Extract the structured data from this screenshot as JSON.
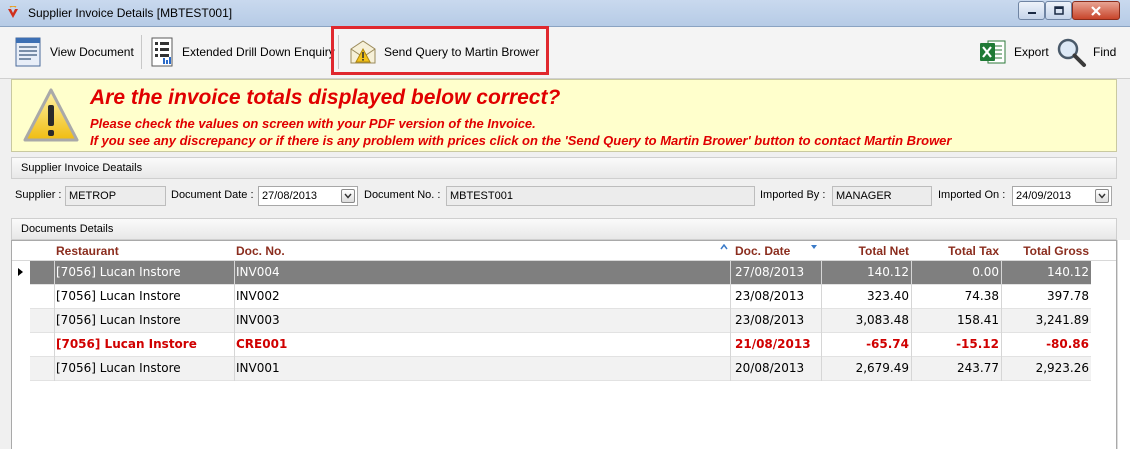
{
  "window": {
    "title": "Supplier Invoice Details [MBTEST001]"
  },
  "toolbar": {
    "view_document": "View Document",
    "extended_drill_down": "Extended Drill Down Enquiry",
    "send_query": "Send Query to Martin Brower",
    "export": "Export",
    "find": "Find"
  },
  "alert": {
    "headline": "Are the invoice totals displayed below correct?",
    "line1": "Please check the values on screen with your PDF version of the Invoice.",
    "line2": "If you see any discrepancy or if there is any problem with prices click on the 'Send Query to Martin Brower' button to contact Martin Brower"
  },
  "supplier_section": {
    "header": "Supplier Invoice Deatails",
    "supplier_label": "Supplier :",
    "supplier_value": "METROP",
    "document_date_label": "Document Date :",
    "document_date_value": "27/08/2013",
    "document_no_label": "Document No. :",
    "document_no_value": "MBTEST001",
    "imported_by_label": "Imported By :",
    "imported_by_value": "MANAGER",
    "imported_on_label": "Imported On :",
    "imported_on_value": "24/09/2013"
  },
  "documents_section": {
    "header": "Documents Details",
    "columns": {
      "restaurant": "Restaurant",
      "doc_no": "Doc. No.",
      "doc_date": "Doc. Date",
      "total_net": "Total Net",
      "total_tax": "Total Tax",
      "total_gross": "Total Gross"
    },
    "rows": [
      {
        "restaurant": "[7056] Lucan Instore",
        "doc_no": "INV004",
        "doc_date": "27/08/2013",
        "total_net": "140.12",
        "total_tax": "0.00",
        "total_gross": "140.12"
      },
      {
        "restaurant": "[7056] Lucan Instore",
        "doc_no": "INV002",
        "doc_date": "23/08/2013",
        "total_net": "323.40",
        "total_tax": "74.38",
        "total_gross": "397.78"
      },
      {
        "restaurant": "[7056] Lucan Instore",
        "doc_no": "INV003",
        "doc_date": "23/08/2013",
        "total_net": "3,083.48",
        "total_tax": "158.41",
        "total_gross": "3,241.89"
      },
      {
        "restaurant": "[7056] Lucan Instore",
        "doc_no": "CRE001",
        "doc_date": "21/08/2013",
        "total_net": "-65.74",
        "total_tax": "-15.12",
        "total_gross": "-80.86"
      },
      {
        "restaurant": "[7056] Lucan Instore",
        "doc_no": "INV001",
        "doc_date": "20/08/2013",
        "total_net": "2,679.49",
        "total_tax": "243.77",
        "total_gross": "2,923.26"
      }
    ]
  },
  "colors": {
    "alert_text": "#e00000",
    "alert_bg": "#ffffcc",
    "header_text": "#8b2d1e",
    "selected_row": "#7f7f7f",
    "highlight_box": "#e0282e"
  },
  "icons": {
    "app": "app-icon",
    "view_document": "document-icon",
    "extended_drill_down": "report-icon",
    "send_query": "envelope-warning-icon",
    "export": "excel-icon",
    "find": "magnifier-icon",
    "alert": "warning-triangle-icon"
  }
}
